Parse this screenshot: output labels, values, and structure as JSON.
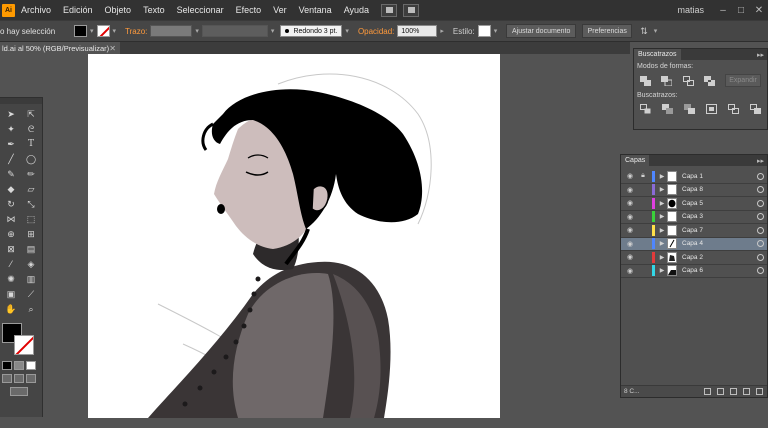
{
  "app": {
    "logo_letter": "Ai"
  },
  "menubar": {
    "items": [
      "Archivo",
      "Edición",
      "Objeto",
      "Texto",
      "Seleccionar",
      "Efecto",
      "Ver",
      "Ventana",
      "Ayuda"
    ],
    "user": "matias",
    "window_buttons": [
      "–",
      "□",
      "✕"
    ]
  },
  "controlbar": {
    "selection_text": "o hay selección",
    "stroke_label": "Trazo:",
    "brush_label": "Redondo 3 pt.",
    "opacity_label": "Opacidad:",
    "opacity_value": "100%",
    "style_label": "Estilo:",
    "doc_setup_button": "Ajustar documento",
    "prefs_button": "Preferencias"
  },
  "document": {
    "tab_title": "ld.ai al 50% (RGB/Previsualizar)",
    "close_glyph": "✕"
  },
  "pathfinder": {
    "tab": "Buscatrazos",
    "shape_modes_label": "Modos de formas:",
    "pathfinders_label": "Buscatrazos:",
    "expand_button": "Expandir",
    "menu_glyph": "▸▸"
  },
  "layers": {
    "tab": "Capas",
    "menu_glyph": "▸▸",
    "rows": [
      {
        "name": "Capa 1",
        "color": "#4f86ff",
        "locked": true,
        "selected": false,
        "thumb": "blank"
      },
      {
        "name": "Capa 8",
        "color": "#8a6bd6",
        "locked": false,
        "selected": false,
        "thumb": "blank"
      },
      {
        "name": "Capa 5",
        "color": "#e040e0",
        "locked": false,
        "selected": false,
        "thumb": "hair"
      },
      {
        "name": "Capa 3",
        "color": "#3ad13a",
        "locked": false,
        "selected": false,
        "thumb": "blank"
      },
      {
        "name": "Capa 7",
        "color": "#ffe04a",
        "locked": false,
        "selected": false,
        "thumb": "blank"
      },
      {
        "name": "Capa 4",
        "color": "#4f86ff",
        "locked": false,
        "selected": true,
        "thumb": "line"
      },
      {
        "name": "Capa 2",
        "color": "#e23b3b",
        "locked": false,
        "selected": false,
        "thumb": "face"
      },
      {
        "name": "Capa 6",
        "color": "#33d7e6",
        "locked": false,
        "selected": false,
        "thumb": "body"
      }
    ],
    "count_label": "8 C..."
  },
  "colors": {
    "accent_orange": "#ff9a3c",
    "canvas_bg": "#ffffff",
    "skin": "#cdbdbc",
    "hair": "#000000",
    "dress_dark": "#3a3536",
    "dress_mid": "#6f6869"
  }
}
